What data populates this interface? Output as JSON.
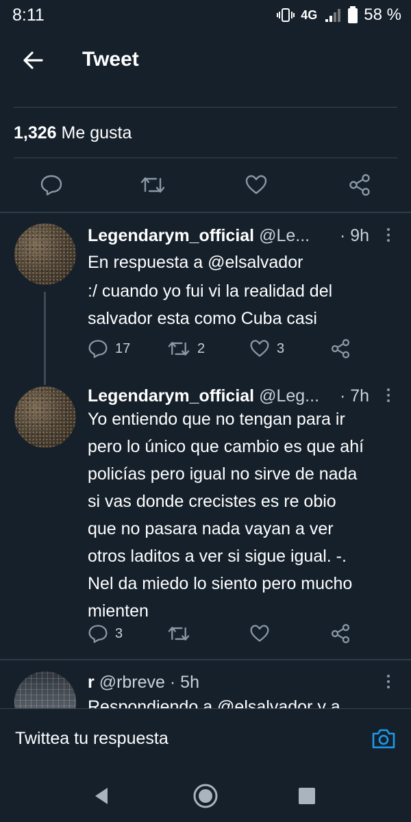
{
  "status_bar": {
    "time": "8:11",
    "network": "4G",
    "battery": "58 %"
  },
  "header": {
    "title": "Tweet"
  },
  "stats": {
    "likes_count": "1,326",
    "likes_label": "Me gusta"
  },
  "tweets": [
    {
      "name": "Legendarym_official",
      "handle": "@Le...",
      "time": "· 9h",
      "reply_to": "En respuesta a @elsalvador",
      "text_lines": [
        ":/ cuando yo fui vi la realidad del",
        "salvador esta como Cuba casi"
      ],
      "replies": "17",
      "retweets": "2",
      "likes": "3"
    },
    {
      "name": "Legendarym_official",
      "handle": "@Leg...",
      "time": "· 7h",
      "text_lines": [
        "Yo entiendo que no tengan para ir",
        "pero lo único que cambio es que ahí",
        "policías pero igual no sirve de nada",
        "si vas donde crecistes es re obio",
        "que no pasara nada vayan a ver",
        "otros laditos a ver si sigue igual. -.",
        "Nel da miedo lo siento pero mucho",
        "mienten"
      ],
      "replies": "3"
    },
    {
      "name": "r",
      "handle": "@rbreve",
      "time": "· 5h",
      "reply_to_partial": "Respondiendo a @elsalvador y a"
    }
  ],
  "composer": {
    "placeholder": "Twittea tu respuesta"
  },
  "icons": {
    "back": "arrow-left-icon",
    "reply": "speech-bubble-icon",
    "retweet": "retweet-icon",
    "like": "heart-icon",
    "share": "share-icon",
    "camera": "camera-icon",
    "more": "vertical-dots-icon"
  },
  "colors": {
    "background": "#15202b",
    "divider": "#38444d",
    "accent": "#1d9bf0",
    "icon_gray": "#8b98a5"
  }
}
